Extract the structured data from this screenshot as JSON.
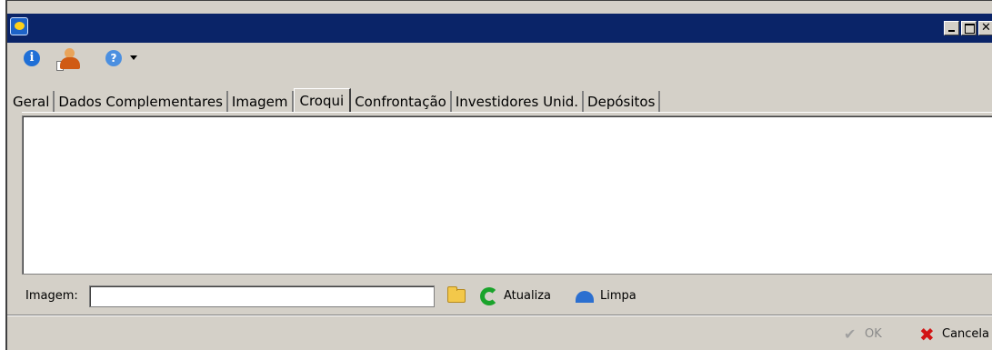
{
  "window": {
    "title": "",
    "controls": [
      "minimize",
      "maximize",
      "close"
    ]
  },
  "toolbar": {
    "icons": [
      "info-icon",
      "user-icon",
      "help-icon",
      "dropdown-icon"
    ],
    "info_glyph": "i",
    "help_glyph": "?"
  },
  "tabs": [
    {
      "label": "Geral",
      "active": false
    },
    {
      "label": "Dados Complementares",
      "active": false
    },
    {
      "label": "Imagem",
      "active": false
    },
    {
      "label": "Croqui",
      "active": true
    },
    {
      "label": "Confrontação",
      "active": false
    },
    {
      "label": "Investidores Unid.",
      "active": false
    },
    {
      "label": "Depósitos",
      "active": false
    }
  ],
  "image_row": {
    "label": "Imagem:",
    "value": "",
    "atualiza_label": "Atualiza",
    "limpa_label": "Limpa"
  },
  "footer": {
    "ok_label": "OK",
    "cancel_label": "Cancela"
  },
  "colors": {
    "titlebar": "#0a2468",
    "window_bg": "#d4d0c8",
    "cancel_icon": "#d21414",
    "refresh_icon": "#1aa32b"
  }
}
